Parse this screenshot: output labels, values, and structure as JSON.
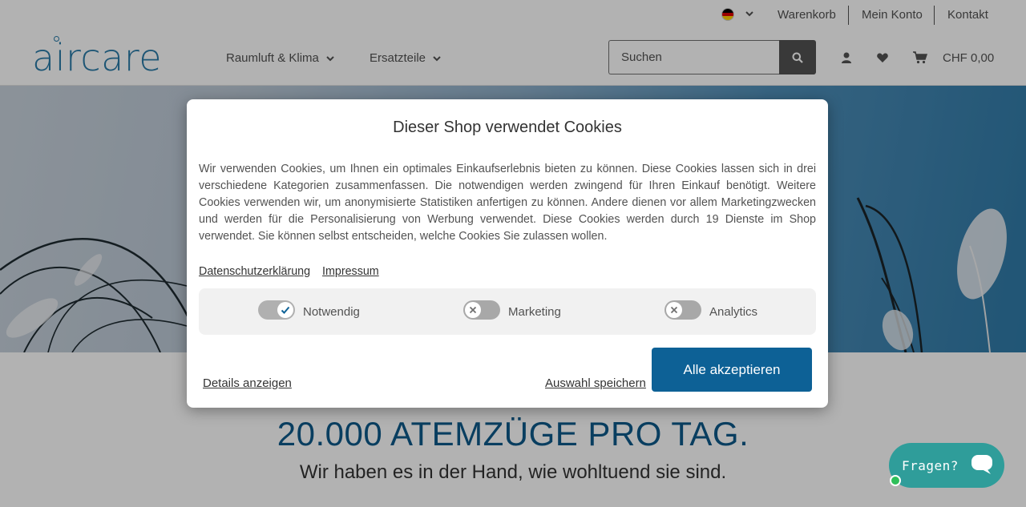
{
  "topbar": {
    "language_icon": "flag-de-icon",
    "links": [
      "Warenkorb",
      "Mein Konto",
      "Kontakt"
    ]
  },
  "header": {
    "logo_text": "aircare",
    "nav": [
      {
        "label": "Raumluft & Klima"
      },
      {
        "label": "Ersatzteile"
      }
    ],
    "search": {
      "placeholder": "Suchen"
    },
    "cart_total": "CHF 0,00"
  },
  "hero": {
    "headline": "20.000 ATEMZÜGE PRO TAG.",
    "subline": "Wir haben es in der Hand, wie wohltuend sie sind."
  },
  "chat": {
    "label": "Fragen?"
  },
  "cookie_modal": {
    "title": "Dieser Shop verwendet Cookies",
    "text": "Wir verwenden Cookies, um Ihnen ein optimales Einkaufserlebnis bieten zu können. Diese Cookies lassen sich in drei verschiedene Kategorien zusammenfassen. Die notwendigen werden zwingend für Ihren Einkauf benötigt. Weitere Cookies verwenden wir, um anonymisierte Statistiken anfertigen zu können. Andere dienen vor allem Marketingzwecken und werden für die Personalisierung von Werbung verwendet. Diese Cookies werden durch 19 Dienste im Shop verwendet. Sie können selbst entscheiden, welche Cookies Sie zulassen wollen.",
    "privacy_link": "Datenschutzerklärung",
    "imprint_link": "Impressum",
    "toggles": [
      {
        "label": "Notwendig",
        "enabled": true
      },
      {
        "label": "Marketing",
        "enabled": false
      },
      {
        "label": "Analytics",
        "enabled": false
      }
    ],
    "details_link": "Details anzeigen",
    "save_link": "Auswahl speichern",
    "accept_button": "Alle akzeptieren"
  },
  "colors": {
    "brand": "#2b7ca8",
    "accept_button": "#0d6196",
    "headline": "#0d5a8a",
    "chat": "#2f9d9a"
  }
}
